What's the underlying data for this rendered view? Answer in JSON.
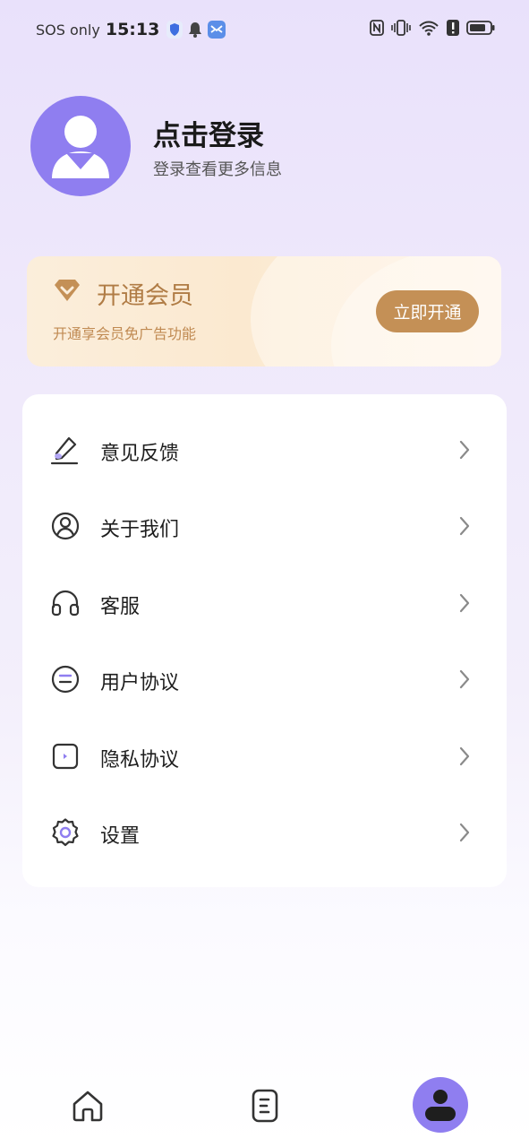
{
  "status_bar": {
    "carrier": "SOS only",
    "time": "15:13"
  },
  "profile": {
    "title": "点击登录",
    "subtitle": "登录查看更多信息"
  },
  "vip": {
    "title": "开通会员",
    "subtitle": "开通享会员免广告功能",
    "button_label": "立即开通"
  },
  "menu": {
    "items": [
      {
        "label": "意见反馈",
        "icon": "pen-feedback-icon"
      },
      {
        "label": "关于我们",
        "icon": "user-circle-icon"
      },
      {
        "label": "客服",
        "icon": "headphones-icon"
      },
      {
        "label": "用户协议",
        "icon": "agreement-icon"
      },
      {
        "label": "隐私协议",
        "icon": "privacy-icon"
      },
      {
        "label": "设置",
        "icon": "gear-icon"
      }
    ]
  },
  "nav": {
    "items": [
      "home-icon",
      "document-icon",
      "profile-icon"
    ],
    "active": "profile-icon"
  },
  "colors": {
    "accent": "#8f7ef0",
    "vip_gold": "#c49056"
  }
}
